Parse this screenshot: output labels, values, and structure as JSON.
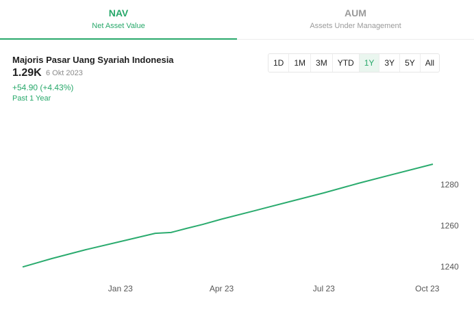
{
  "tabs": {
    "nav": {
      "title": "NAV",
      "subtitle": "Net Asset Value"
    },
    "aum": {
      "title": "AUM",
      "subtitle": "Assets Under Management"
    }
  },
  "fund": {
    "name": "Majoris Pasar Uang Syariah Indonesia",
    "value": "1.29K",
    "date": "6 Okt 2023",
    "change": "+54.90 (+4.43%)",
    "period": "Past 1 Year"
  },
  "ranges": [
    "1D",
    "1M",
    "3M",
    "YTD",
    "1Y",
    "3Y",
    "5Y",
    "All"
  ],
  "active_range": "1Y",
  "colors": {
    "accent": "#27a86a",
    "line": "#2aab6e"
  },
  "chart_data": {
    "type": "line",
    "title": "",
    "xlabel": "",
    "ylabel": "",
    "x_ticks": [
      "Jan 23",
      "Apr 23",
      "Jul 23",
      "Oct 23"
    ],
    "y_ticks": [
      1240,
      1260,
      1280
    ],
    "ylim": [
      1238,
      1296
    ],
    "grid": false,
    "series": [
      {
        "x": [
          "2022-10-06",
          "2022-11-01",
          "2022-12-01",
          "2023-01-01",
          "2023-02-01",
          "2023-02-15",
          "2023-03-01",
          "2023-03-15",
          "2023-04-01",
          "2023-05-01",
          "2023-06-01",
          "2023-07-01",
          "2023-08-01",
          "2023-09-01",
          "2023-10-06"
        ],
        "values": [
          1239.9,
          1244.0,
          1248.3,
          1252.3,
          1256.3,
          1256.7,
          1258.7,
          1260.6,
          1263.2,
          1267.4,
          1271.8,
          1276.0,
          1280.7,
          1285.1,
          1290.0
        ]
      }
    ]
  }
}
